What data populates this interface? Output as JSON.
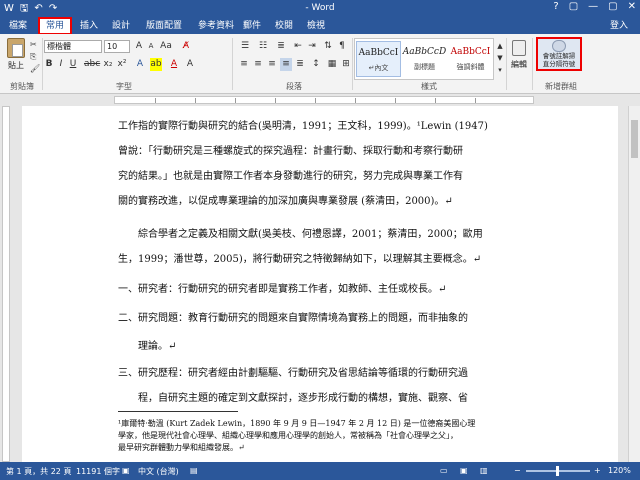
{
  "window": {
    "title": "- Word",
    "controls": [
      "?",
      "▢",
      "—",
      "▢",
      "✕"
    ]
  },
  "tabs": [
    {
      "label": "檔案"
    },
    {
      "label": "常用"
    },
    {
      "label": "插入"
    },
    {
      "label": "設計"
    },
    {
      "label": "版面配置"
    },
    {
      "label": "參考資料"
    },
    {
      "label": "郵件"
    },
    {
      "label": "校閱"
    },
    {
      "label": "檢視"
    }
  ],
  "login": "登入",
  "ribbon": {
    "paste_label": "貼上",
    "font_name": "標楷體",
    "font_size": "10",
    "groups": [
      "剪貼簿",
      "字型",
      "段落",
      "樣式",
      "新增群組"
    ],
    "styles": [
      {
        "preview": "AaBbCcI",
        "name": "↵內文"
      },
      {
        "preview": "AaBbCcD",
        "name": "副標題"
      },
      {
        "preview": "AaBbCcI",
        "name": "強調斜體"
      }
    ],
    "edit_label": "編輯",
    "addin_text": [
      "會號註解掃",
      "直分隔符號"
    ]
  },
  "document": {
    "lines": [
      "工作指的實際行動與研究的結合(吳明清，1991；王文科，1999)。¹Lewin (1947)",
      "曾說：「行動研究是三種螺旋式的探究過程：計畫行動、採取行動和考察行動研",
      "究的結果。」也就是由實際工作者本身發動進行的研究，努力完成與專業工作有",
      "關的實務改進，以促成專業理論的加深加廣與專業發展 (蔡清田，2000)。↵",
      "　　綜合學者之定義及相關文獻(吳美枝、何禮恩譯，2001；蔡清田，2000；歐用",
      "生，1999；潘世尊，2005)，將行動研究之特徵歸納如下，以理解其主要概念。↵",
      "一、研究者：行動研究的研究者即是實務工作者，如教師、主任或校長。↵",
      "二、研究問題：教育行動研究的問題來自實際情境為實務上的問題，而非抽象的",
      "　　理論。↵",
      "三、研究歷程：研究者經由計劃驅驅、行動研究及省思結論等循環的行動研究過",
      "　　程，自研究主題的確定到文獻探討，逐步形成行動的構想，實施、觀察、省"
    ],
    "footnote": [
      "¹庫爾特·勒溫 (Kurt Zadek Lewin，1890 年 9 月 9 日—1947 年 2 月 12 日) 是一位德裔美國心理",
      "學家，他是現代社會心理學、組織心理學和應用心理學的創始人，常被稱為「社會心理學之父」，",
      "最早研究群體動力學和組織發展。↵"
    ]
  },
  "status": {
    "page": "第 1 頁，共 22 頁",
    "words": "11191 個字",
    "language": "中文 (台灣)",
    "zoom": "120%"
  }
}
